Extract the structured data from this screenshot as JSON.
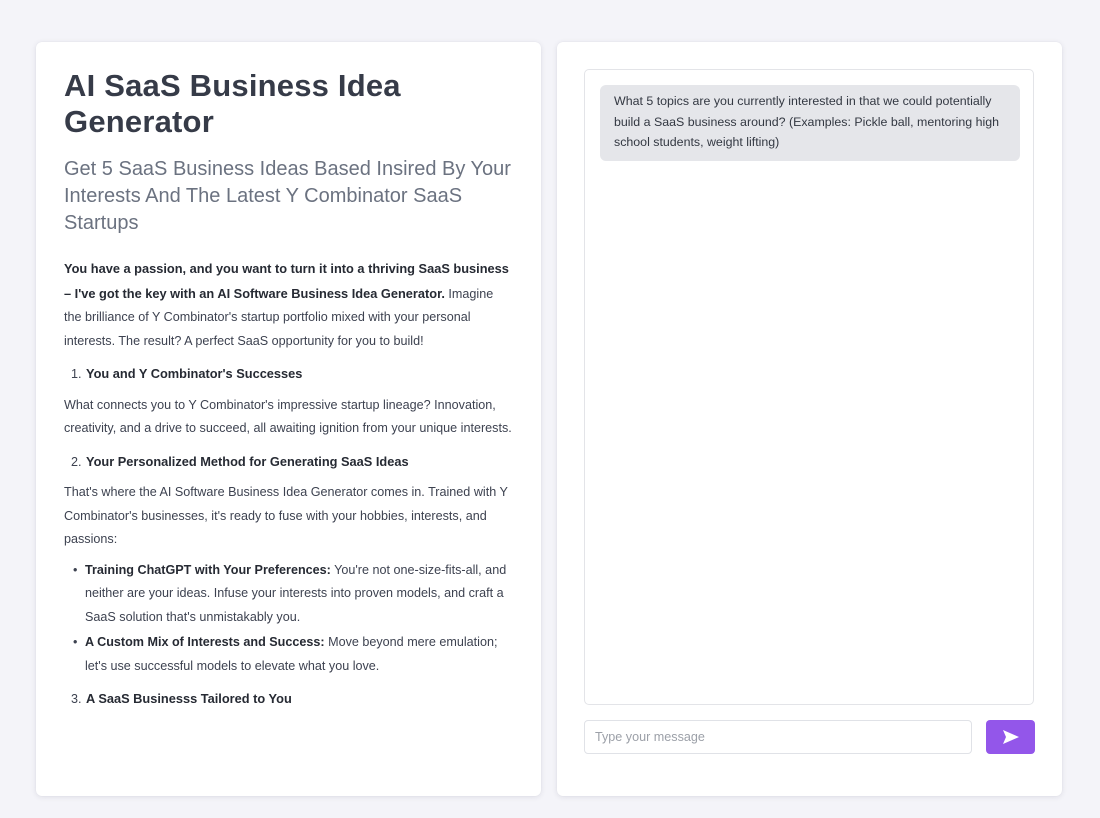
{
  "left": {
    "title": "AI SaaS Business Idea Generator",
    "subtitle": "Get 5 SaaS Business Ideas Based Insired By Your Interests And The Latest Y Combinator SaaS Startups",
    "intro_bold": "You have a passion, and you want to turn it into a thriving SaaS business – I've got the key with an AI Software Business Idea Generator.",
    "intro_text": " Imagine the brilliance of Y Combinator's startup portfolio mixed with your personal interests. The result? A perfect SaaS opportunity for you to build!",
    "section1": {
      "number": "1.",
      "heading": "You and Y Combinator's Successes"
    },
    "para1": "What connects you to Y Combinator's impressive startup lineage? Innovation, creativity, and a drive to succeed, all awaiting ignition from your unique interests.",
    "section2": {
      "number": "2.",
      "heading": "Your Personalized Method for Generating SaaS Ideas"
    },
    "para2": "That's where the AI Software Business Idea Generator comes in. Trained with Y Combinator's businesses, it's ready to fuse with your hobbies, interests, and passions:",
    "bullets": [
      {
        "bold": "Training ChatGPT with Your Preferences:",
        "text": " You're not one-size-fits-all, and neither are your ideas. Infuse your interests into proven models, and craft a SaaS solution that's unmistakably you."
      },
      {
        "bold": "A Custom Mix of Interests and Success:",
        "text": " Move beyond mere emulation; let's use successful models to elevate what you love."
      }
    ],
    "section3": {
      "number": "3.",
      "heading": "A SaaS Businesss Tailored to You"
    }
  },
  "chat": {
    "messages": [
      {
        "role": "assistant",
        "text": "What 5 topics are you currently interested in that we could potentially build a SaaS business around? (Examples: Pickle ball, mentoring high school students, weight lifting)"
      }
    ],
    "input_placeholder": "Type your message",
    "input_value": "",
    "send_icon": "send-arrow-icon",
    "accent_color": "#9356ea"
  }
}
